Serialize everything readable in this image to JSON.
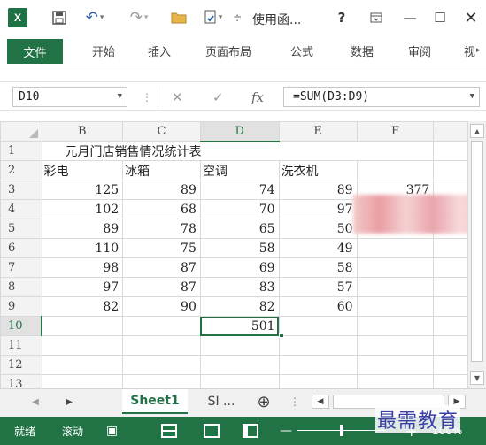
{
  "titlebar": {
    "title": "使用函...",
    "help": "?",
    "qat_icons": [
      "excel-icon",
      "save-icon",
      "undo-icon",
      "redo-icon",
      "open-folder-icon",
      "file-check-icon",
      "customize-icon"
    ]
  },
  "ribbon": {
    "tabs": [
      "文件",
      "开始",
      "插入",
      "页面布局",
      "公式",
      "数据",
      "审阅",
      "视"
    ]
  },
  "formula_bar": {
    "name_box": "D10",
    "fx": "fx",
    "formula": "=SUM(D3:D9)"
  },
  "sheet": {
    "columns": [
      "B",
      "C",
      "D",
      "E",
      "F"
    ],
    "selected_column": "D",
    "selected_row": "10",
    "rows": [
      {
        "n": "1",
        "cells": [
          "元月门店销售情况统计表",
          "",
          "",
          "",
          ""
        ]
      },
      {
        "n": "2",
        "cells": [
          "彩电",
          "冰箱",
          "空调",
          "洗衣机",
          ""
        ]
      },
      {
        "n": "3",
        "cells": [
          "125",
          "89",
          "74",
          "89",
          "377"
        ]
      },
      {
        "n": "4",
        "cells": [
          "102",
          "68",
          "70",
          "97",
          ""
        ]
      },
      {
        "n": "5",
        "cells": [
          "89",
          "78",
          "65",
          "50",
          ""
        ]
      },
      {
        "n": "6",
        "cells": [
          "110",
          "75",
          "58",
          "49",
          ""
        ]
      },
      {
        "n": "7",
        "cells": [
          "98",
          "87",
          "69",
          "58",
          ""
        ]
      },
      {
        "n": "8",
        "cells": [
          "97",
          "87",
          "83",
          "57",
          ""
        ]
      },
      {
        "n": "9",
        "cells": [
          "82",
          "90",
          "82",
          "60",
          ""
        ]
      },
      {
        "n": "10",
        "cells": [
          "",
          "",
          "501",
          "",
          ""
        ]
      },
      {
        "n": "11",
        "cells": [
          "",
          "",
          "",
          "",
          ""
        ]
      },
      {
        "n": "12",
        "cells": [
          "",
          "",
          "",
          "",
          ""
        ]
      },
      {
        "n": "13",
        "cells": [
          "",
          "",
          "",
          "",
          ""
        ]
      }
    ]
  },
  "sheet_tabs": {
    "active": "Sheet1",
    "other": "SI ...",
    "add": "⊕"
  },
  "status_bar": {
    "ready": "就绪",
    "scroll": "滚动",
    "zoom": "100%"
  },
  "watermark": "最需教育",
  "colors": {
    "accent": "#217346",
    "status_bar": "#217346"
  }
}
